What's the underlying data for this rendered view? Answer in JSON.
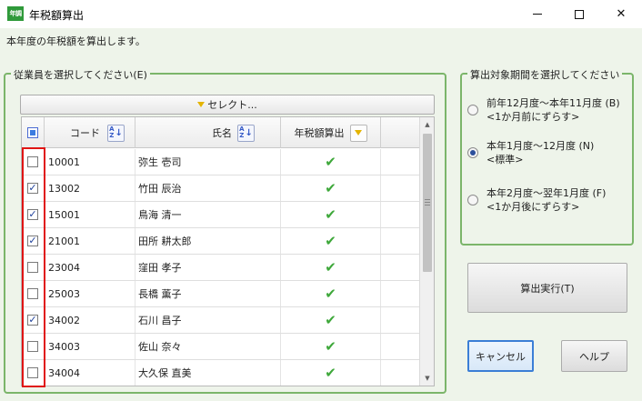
{
  "window": {
    "app_icon": "年調",
    "title": "年税額算出",
    "minimize_icon": "minimize-icon",
    "maximize_icon": "maximize-icon",
    "close_glyph": "✕"
  },
  "subtitle": "本年度の年税額を算出します。",
  "employee_group": {
    "legend": "従業員を選択してください(E)",
    "select_button": "セレクト...",
    "columns": {
      "code": "コード",
      "name": "氏名",
      "calc": "年税額算出"
    },
    "sort_icon": "sort-az-icon",
    "filter_icon": "filter-triangle-icon",
    "rows": [
      {
        "checked": false,
        "code": "10001",
        "name": "弥生 壱司",
        "calc_done": true
      },
      {
        "checked": true,
        "code": "13002",
        "name": "竹田 辰治",
        "calc_done": true
      },
      {
        "checked": true,
        "code": "15001",
        "name": "鳥海 清一",
        "calc_done": true
      },
      {
        "checked": true,
        "code": "21001",
        "name": "田所 耕太郎",
        "calc_done": true
      },
      {
        "checked": false,
        "code": "23004",
        "name": "窪田 孝子",
        "calc_done": true
      },
      {
        "checked": false,
        "code": "25003",
        "name": "長橋 薫子",
        "calc_done": true
      },
      {
        "checked": true,
        "code": "34002",
        "name": "石川 昌子",
        "calc_done": true
      },
      {
        "checked": false,
        "code": "34003",
        "name": "佐山 奈々",
        "calc_done": true
      },
      {
        "checked": false,
        "code": "34004",
        "name": "大久保 直美",
        "calc_done": true
      }
    ]
  },
  "period_group": {
    "legend": "算出対象期間を選択してください",
    "options": [
      {
        "line1": "前年12月度～本年11月度 (B)",
        "line2": "<1か月前にずらす>",
        "selected": false
      },
      {
        "line1": "本年1月度～12月度 (N)",
        "line2": "<標準>",
        "selected": true
      },
      {
        "line1": "本年2月度～翌年1月度 (F)",
        "line2": "<1か月後にずらす>",
        "selected": false
      }
    ]
  },
  "buttons": {
    "run": "算出実行(T)",
    "cancel": "キャンセル",
    "help": "ヘルプ"
  },
  "colors": {
    "accent_green": "#7bb56a",
    "check_green": "#3ea83a",
    "highlight_red": "#e01515",
    "focus_blue": "#3b7ed6"
  }
}
